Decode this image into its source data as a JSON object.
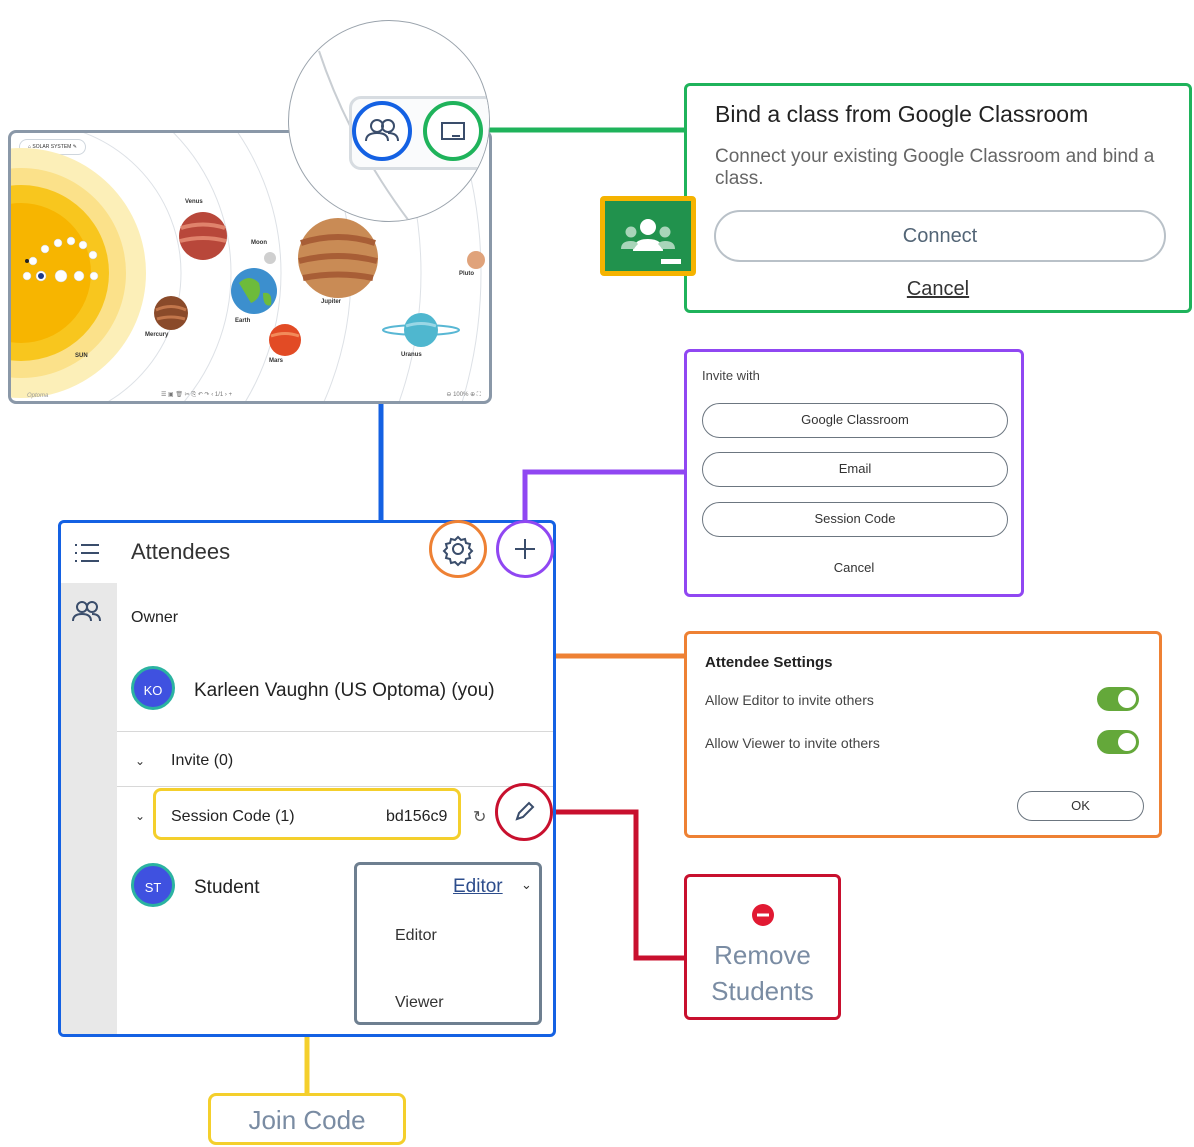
{
  "whiteboard": {
    "title": "SOLAR SYSTEM",
    "planets": [
      "Venus",
      "Moon",
      "Jupiter",
      "Pluto",
      "Earth",
      "Mercury",
      "Mars",
      "Uranus",
      "SUN"
    ],
    "page_indicator": "1/1",
    "zoom": "100%",
    "brand": "Optoma"
  },
  "google_classroom": {
    "title": "Bind a class from Google Classroom",
    "description": "Connect your existing Google Classroom and bind a class.",
    "connect_label": "Connect",
    "cancel_label": "Cancel"
  },
  "invite_dialog": {
    "title": "Invite with",
    "options": [
      "Google Classroom",
      "Email",
      "Session Code"
    ],
    "cancel_label": "Cancel"
  },
  "attendees": {
    "title": "Attendees",
    "owner_label": "Owner",
    "owner": {
      "initials": "KO",
      "name": "Karleen Vaughn (US Optoma) (you)"
    },
    "invite_label": "Invite (0)",
    "session_label": "Session Code (1)",
    "session_code": "bd156c9",
    "student": {
      "initials": "ST",
      "name": "Student"
    },
    "role_selected": "Editor",
    "role_options": [
      "Editor",
      "Viewer"
    ]
  },
  "attendee_settings": {
    "title": "Attendee Settings",
    "editor_invite_label": "Allow Editor to invite others",
    "editor_invite_enabled": true,
    "viewer_invite_label": "Allow Viewer to invite others",
    "viewer_invite_enabled": true,
    "ok_label": "OK"
  },
  "callouts": {
    "remove_students": "Remove Students",
    "join_code": "Join Code"
  },
  "colors": {
    "attendees": "#1461e3",
    "google_classroom": "#1fb35b",
    "invite": "#9047f2",
    "settings": "#ee8134",
    "remove": "#c8102e",
    "join_code": "#f4cf2c",
    "toggle_on": "#64a83a"
  },
  "icons": [
    "people-icon",
    "classroom-icon",
    "menu-icon",
    "gear-icon",
    "plus-icon",
    "pencil-icon",
    "refresh-icon",
    "chevron-down-icon",
    "remove-icon",
    "google-classroom-logo"
  ]
}
